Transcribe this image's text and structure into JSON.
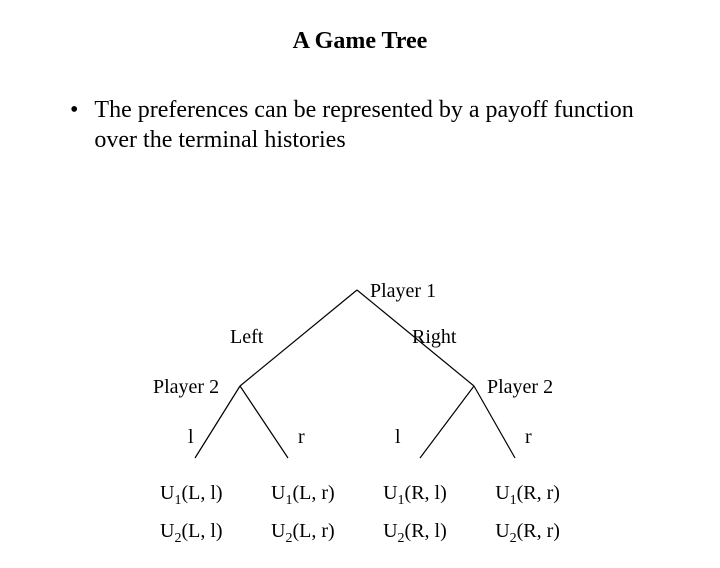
{
  "title": "A Game Tree",
  "bullet": "The preferences can be represented by a payoff function over the terminal histories",
  "tree": {
    "root": "Player 1",
    "branch_left": "Left",
    "branch_right": "Right",
    "node_left": "Player 2",
    "node_right": "Player 2",
    "leaf_ll": "l",
    "leaf_lr": "r",
    "leaf_rl": "l",
    "leaf_rr": "r"
  },
  "payoffs": {
    "u1": [
      "U",
      "1",
      "(L, l)",
      "U",
      "1",
      "(L, r)",
      "U",
      "1",
      "(R, l)",
      "U",
      "1",
      "(R, r)"
    ],
    "u2": [
      "U",
      "2",
      "(L, l)",
      "U",
      "2",
      "(L, r)",
      "U",
      "2",
      "(R, l)",
      "U",
      "2",
      "(R, r)"
    ]
  },
  "chart_data": {
    "type": "tree",
    "title": "A Game Tree",
    "players": [
      "Player 1",
      "Player 2"
    ],
    "moves": {
      "Player 1": [
        "Left",
        "Right"
      ],
      "Player 2": [
        "l",
        "r"
      ]
    },
    "terminal_histories": [
      "(L, l)",
      "(L, r)",
      "(R, l)",
      "(R, r)"
    ],
    "payoff_labels": {
      "Player 1": [
        "U1(L, l)",
        "U1(L, r)",
        "U1(R, l)",
        "U1(R, r)"
      ],
      "Player 2": [
        "U2(L, l)",
        "U2(L, r)",
        "U2(R, l)",
        "U2(R, r)"
      ]
    }
  }
}
